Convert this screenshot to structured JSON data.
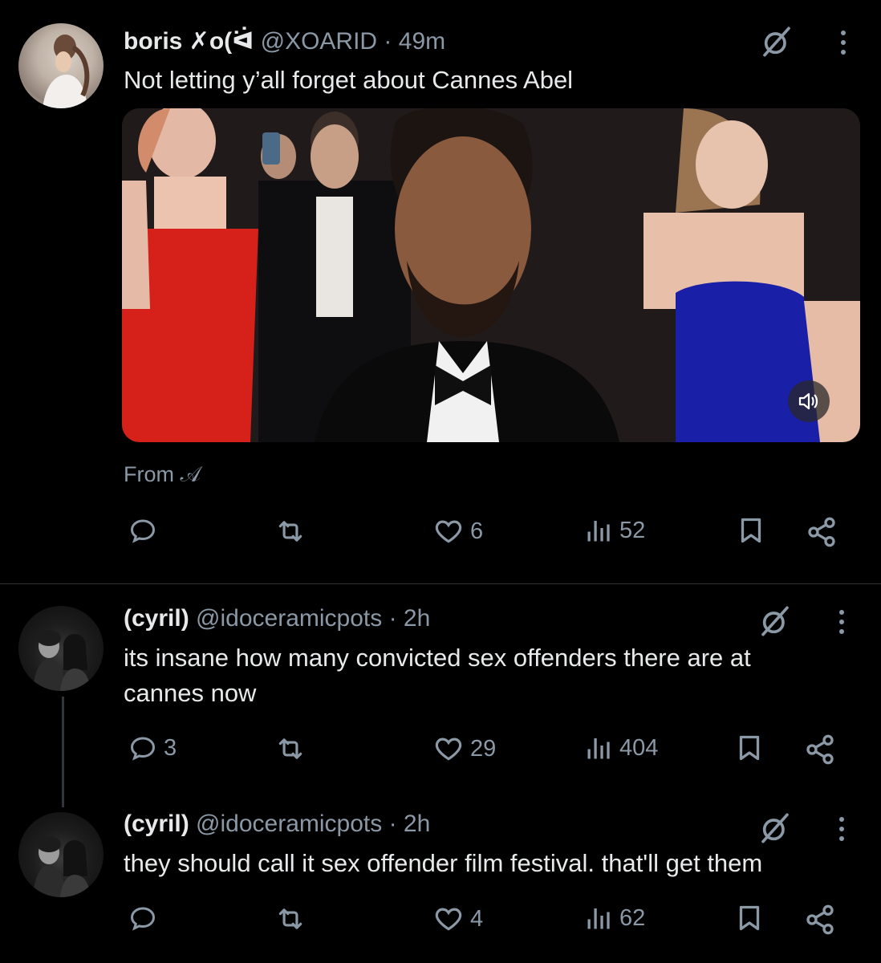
{
  "tweets": [
    {
      "name": "boris ✗o(ᐛ",
      "handle": "@XOARID · 49m",
      "text": "Not letting y’all forget about Cannes Abel",
      "media_source": "From 𝒜",
      "reply_count": "",
      "repost_count": "",
      "like_count": "6",
      "view_count": "52"
    },
    {
      "name": "(cyril)",
      "handle": "@idoceramicpots · 2h",
      "text": "its insane how many convicted sex offenders there are at cannes now",
      "reply_count": "3",
      "repost_count": "",
      "like_count": "29",
      "view_count": "404"
    },
    {
      "name": "(cyril)",
      "handle": "@idoceramicpots · 2h",
      "text": "they should call it sex offender film festival. that'll get them",
      "reply_count": "",
      "repost_count": "",
      "like_count": "4",
      "view_count": "62"
    }
  ],
  "icons": {
    "grok": "grok-icon",
    "more": "more-icon",
    "reply": "reply-icon",
    "repost": "repost-icon",
    "like": "heart-icon",
    "views": "views-icon",
    "bookmark": "bookmark-icon",
    "share": "share-icon",
    "volume": "volume-icon"
  },
  "colors": {
    "background": "#000000",
    "text": "#e7e9ea",
    "muted": "#8b98a5",
    "divider": "#2f3336"
  }
}
